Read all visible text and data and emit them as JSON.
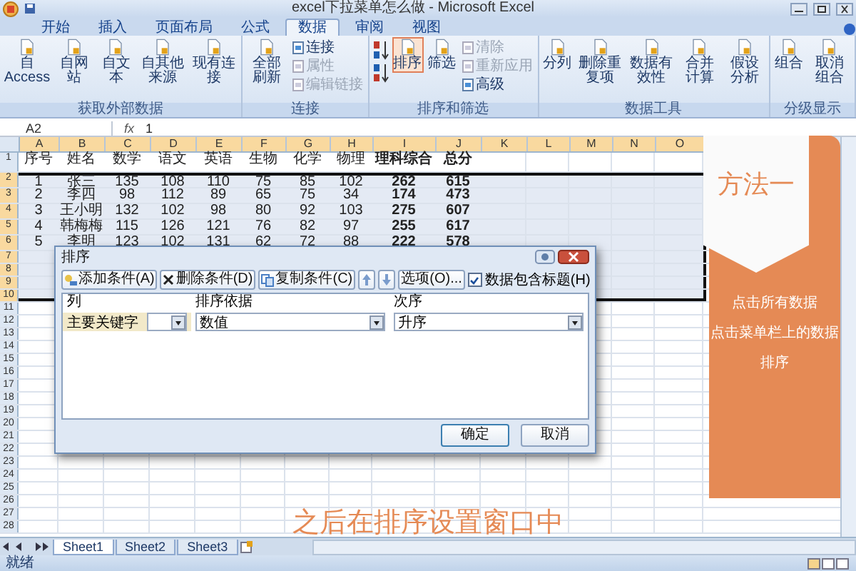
{
  "window": {
    "title": "excel下拉菜单怎么做 - Microsoft Excel"
  },
  "ribbon_tabs": [
    {
      "label": "开始",
      "selected": false
    },
    {
      "label": "插入",
      "selected": false
    },
    {
      "label": "页面布局",
      "selected": false
    },
    {
      "label": "公式",
      "selected": false
    },
    {
      "label": "数据",
      "selected": true
    },
    {
      "label": "审阅",
      "selected": false
    },
    {
      "label": "视图",
      "selected": false
    }
  ],
  "ribbon_groups": [
    {
      "label": "获取外部数据",
      "buttons": [
        {
          "kind": "large",
          "label": "自 Access",
          "disabled": false,
          "highlighted": false
        },
        {
          "kind": "large",
          "label": "自网站",
          "disabled": false,
          "highlighted": false
        },
        {
          "kind": "large",
          "label": "自文本",
          "disabled": false,
          "highlighted": false
        },
        {
          "kind": "large",
          "label": "自其他来源",
          "disabled": false,
          "highlighted": false
        },
        {
          "kind": "large",
          "label": "现有连接",
          "disabled": false,
          "highlighted": false
        }
      ]
    },
    {
      "label": "连接",
      "buttons": [
        {
          "kind": "large",
          "label": "全部刷新",
          "disabled": false,
          "highlighted": false
        },
        {
          "kind": "small",
          "label": "连接",
          "disabled": false,
          "highlighted": false
        },
        {
          "kind": "small",
          "label": "属性",
          "disabled": true,
          "highlighted": false
        },
        {
          "kind": "small",
          "label": "编辑链接",
          "disabled": true,
          "highlighted": false
        }
      ]
    },
    {
      "label": "排序和筛选",
      "buttons": [
        {
          "kind": "sort_pair",
          "disabled": false
        },
        {
          "kind": "large",
          "label": "排序",
          "disabled": false,
          "highlighted": true
        },
        {
          "kind": "large",
          "label": "筛选",
          "disabled": false,
          "highlighted": false
        },
        {
          "kind": "small",
          "label": "清除",
          "disabled": true,
          "highlighted": false
        },
        {
          "kind": "small",
          "label": "重新应用",
          "disabled": true,
          "highlighted": false
        },
        {
          "kind": "small",
          "label": "高级",
          "disabled": false,
          "highlighted": false
        }
      ]
    },
    {
      "label": "数据工具",
      "buttons": [
        {
          "kind": "large",
          "label": "分列",
          "disabled": false,
          "highlighted": false
        },
        {
          "kind": "large",
          "label": "删除重复项",
          "disabled": false,
          "highlighted": false
        },
        {
          "kind": "large",
          "label": "数据有效性",
          "disabled": false,
          "highlighted": false
        },
        {
          "kind": "large",
          "label": "合并计算",
          "disabled": false,
          "highlighted": false
        },
        {
          "kind": "large",
          "label": "假设分析",
          "disabled": false,
          "highlighted": false
        }
      ]
    },
    {
      "label": "分级显示",
      "buttons": [
        {
          "kind": "large",
          "label": "组合",
          "disabled": false,
          "highlighted": false
        },
        {
          "kind": "large",
          "label": "取消组合",
          "disabled": false,
          "highlighted": false
        }
      ]
    }
  ],
  "formula_bar": {
    "name_box": "A2",
    "function_label": "fx",
    "value": "1"
  },
  "sheet": {
    "columns": [
      {
        "label": "A",
        "selected": true
      },
      {
        "label": "B",
        "selected": true
      },
      {
        "label": "C",
        "selected": true
      },
      {
        "label": "D",
        "selected": true
      },
      {
        "label": "E",
        "selected": true
      },
      {
        "label": "F",
        "selected": true
      },
      {
        "label": "G",
        "selected": true
      },
      {
        "label": "H",
        "selected": true
      },
      {
        "label": "I",
        "selected": true
      },
      {
        "label": "J",
        "selected": true
      },
      {
        "label": "K",
        "selected": true
      },
      {
        "label": "L",
        "selected": true
      },
      {
        "label": "M",
        "selected": true
      },
      {
        "label": "N",
        "selected": true
      },
      {
        "label": "O",
        "selected": true
      }
    ],
    "rows": [
      {
        "number": "1",
        "selected": false,
        "cells": [
          {
            "text": "序号",
            "bold": false
          },
          {
            "text": "姓名",
            "bold": false
          },
          {
            "text": "数学",
            "bold": false
          },
          {
            "text": "语文",
            "bold": false
          },
          {
            "text": "英语",
            "bold": false
          },
          {
            "text": "生物",
            "bold": false
          },
          {
            "text": "化学",
            "bold": false
          },
          {
            "text": "物理",
            "bold": false
          },
          {
            "text": "理科综合",
            "bold": true
          },
          {
            "text": "总分",
            "bold": true
          }
        ]
      },
      {
        "number": "2",
        "selected": true,
        "cells": [
          {
            "text": "1",
            "bold": false
          },
          {
            "text": "张三",
            "bold": false
          },
          {
            "text": "135",
            "bold": false
          },
          {
            "text": "108",
            "bold": false
          },
          {
            "text": "110",
            "bold": false
          },
          {
            "text": "75",
            "bold": false
          },
          {
            "text": "85",
            "bold": false
          },
          {
            "text": "102",
            "bold": false
          },
          {
            "text": "262",
            "bold": true
          },
          {
            "text": "615",
            "bold": true
          }
        ]
      },
      {
        "number": "3",
        "selected": true,
        "cells": [
          {
            "text": "2",
            "bold": false
          },
          {
            "text": "李四",
            "bold": false
          },
          {
            "text": "98",
            "bold": false
          },
          {
            "text": "112",
            "bold": false
          },
          {
            "text": "89",
            "bold": false
          },
          {
            "text": "65",
            "bold": false
          },
          {
            "text": "75",
            "bold": false
          },
          {
            "text": "34",
            "bold": false
          },
          {
            "text": "174",
            "bold": true
          },
          {
            "text": "473",
            "bold": true
          }
        ]
      },
      {
        "number": "4",
        "selected": true,
        "cells": [
          {
            "text": "3",
            "bold": false
          },
          {
            "text": "王小明",
            "bold": false
          },
          {
            "text": "132",
            "bold": false
          },
          {
            "text": "102",
            "bold": false
          },
          {
            "text": "98",
            "bold": false
          },
          {
            "text": "80",
            "bold": false
          },
          {
            "text": "92",
            "bold": false
          },
          {
            "text": "103",
            "bold": false
          },
          {
            "text": "275",
            "bold": true
          },
          {
            "text": "607",
            "bold": true
          }
        ]
      },
      {
        "number": "5",
        "selected": true,
        "cells": [
          {
            "text": "4",
            "bold": false
          },
          {
            "text": "韩梅梅",
            "bold": false
          },
          {
            "text": "115",
            "bold": false
          },
          {
            "text": "126",
            "bold": false
          },
          {
            "text": "121",
            "bold": false
          },
          {
            "text": "76",
            "bold": false
          },
          {
            "text": "82",
            "bold": false
          },
          {
            "text": "97",
            "bold": false
          },
          {
            "text": "255",
            "bold": true
          },
          {
            "text": "617",
            "bold": true
          }
        ]
      },
      {
        "number": "6",
        "selected": true,
        "cells": [
          {
            "text": "5",
            "bold": false
          },
          {
            "text": "李明",
            "bold": false
          },
          {
            "text": "123",
            "bold": false
          },
          {
            "text": "102",
            "bold": false
          },
          {
            "text": "131",
            "bold": false
          },
          {
            "text": "62",
            "bold": false
          },
          {
            "text": "72",
            "bold": false
          },
          {
            "text": "88",
            "bold": false
          },
          {
            "text": "222",
            "bold": true
          },
          {
            "text": "578",
            "bold": true
          }
        ]
      },
      {
        "number": "7",
        "selected": true
      },
      {
        "number": "8",
        "selected": true
      },
      {
        "number": "9",
        "selected": true
      },
      {
        "number": "10",
        "selected": true
      },
      {
        "number": "11",
        "selected": false
      },
      {
        "number": "12",
        "selected": false
      },
      {
        "number": "13",
        "selected": false
      },
      {
        "number": "14",
        "selected": false
      },
      {
        "number": "15",
        "selected": false
      },
      {
        "number": "16",
        "selected": false
      },
      {
        "number": "17",
        "selected": false
      },
      {
        "number": "18",
        "selected": false
      },
      {
        "number": "19",
        "selected": false
      },
      {
        "number": "20",
        "selected": false
      },
      {
        "number": "21",
        "selected": false
      },
      {
        "number": "22",
        "selected": false
      },
      {
        "number": "23",
        "selected": false
      },
      {
        "number": "24",
        "selected": false
      },
      {
        "number": "25",
        "selected": false
      },
      {
        "number": "26",
        "selected": false
      },
      {
        "number": "27",
        "selected": false
      },
      {
        "number": "28",
        "selected": false
      }
    ]
  },
  "sort_dialog": {
    "title": "排序",
    "toolbar": [
      {
        "kind": "add",
        "label": "添加条件(A)"
      },
      {
        "kind": "delete",
        "label": "删除条件(D)"
      },
      {
        "kind": "copy",
        "label": "复制条件(C)"
      },
      {
        "kind": "up"
      },
      {
        "kind": "down"
      },
      {
        "kind": "plain",
        "label": "选项(O)..."
      }
    ],
    "header_checkbox": {
      "label": "数据包含标题(H)",
      "checked": true
    },
    "columns": [
      "列",
      "排序依据",
      "次序"
    ],
    "rows": [
      {
        "label": "主要关键字",
        "column": "",
        "sort_on": "数值",
        "order": "升序"
      }
    ],
    "buttons": [
      {
        "label": "确定",
        "default": true
      },
      {
        "label": "取消",
        "default": false
      }
    ]
  },
  "tutorial": {
    "method": "方法一",
    "steps": [
      "点击所有数据",
      "点击菜单栏上的数据",
      "排序"
    ],
    "subtitle": "之后在排序设置窗口中"
  },
  "sheet_tabs": [
    {
      "label": "Sheet1",
      "selected": true
    },
    {
      "label": "Sheet2",
      "selected": false
    },
    {
      "label": "Sheet3",
      "selected": false
    }
  ],
  "status_bar": {
    "text": "就绪"
  }
}
